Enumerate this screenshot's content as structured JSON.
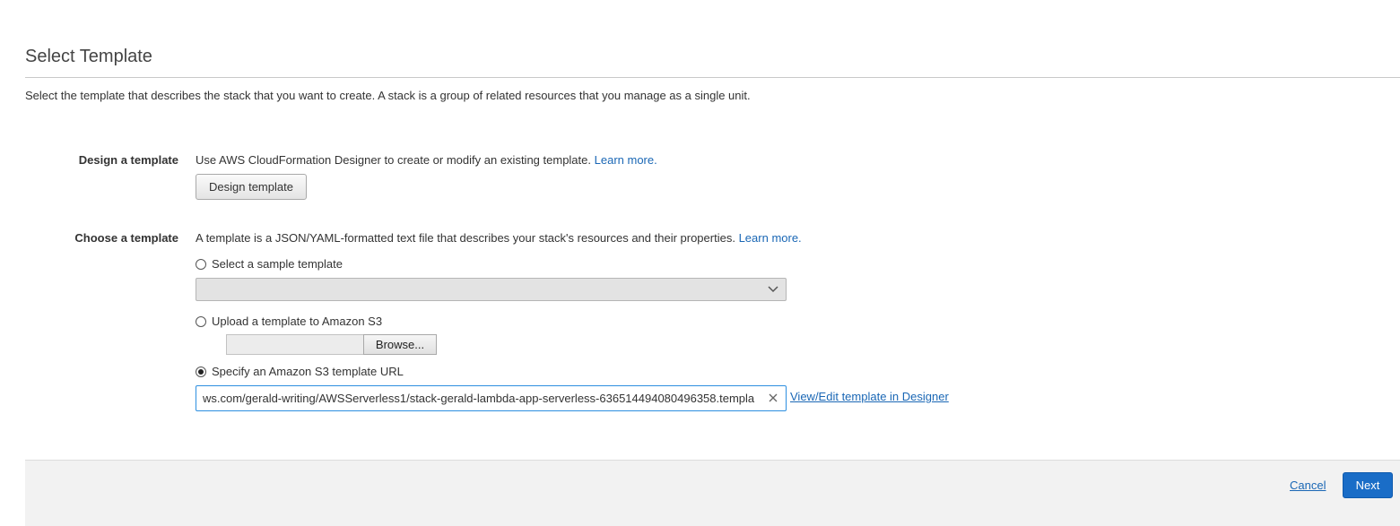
{
  "page": {
    "title": "Select Template",
    "description": "Select the template that describes the stack that you want to create. A stack is a group of related resources that you manage as a single unit."
  },
  "design_section": {
    "label": "Design a template",
    "text": "Use AWS CloudFormation Designer to create or modify an existing template.",
    "learn_more": "Learn more.",
    "button_label": "Design template"
  },
  "choose_section": {
    "label": "Choose a template",
    "text": "A template is a JSON/YAML-formatted text file that describes your stack's resources and their properties.",
    "learn_more": "Learn more.",
    "options": [
      {
        "label": "Select a sample template",
        "selected": false
      },
      {
        "label": "Upload a template to Amazon S3",
        "selected": false
      },
      {
        "label": "Specify an Amazon S3 template URL",
        "selected": true
      }
    ],
    "sample_select_value": "",
    "browse_label": "Browse...",
    "url_value": "ws.com/gerald-writing/AWSServerless1/stack-gerald-lambda-app-serverless-636514494080496358.templa",
    "designer_link": "View/Edit template in Designer"
  },
  "footer": {
    "cancel_label": "Cancel",
    "next_label": "Next"
  },
  "icons": {
    "select_arrow": "chevron-down-icon",
    "clear": "close-icon"
  },
  "colors": {
    "link": "#1a67b5",
    "primary_button": "#1a6dc7",
    "input_focus_border": "#2d8fe0"
  }
}
